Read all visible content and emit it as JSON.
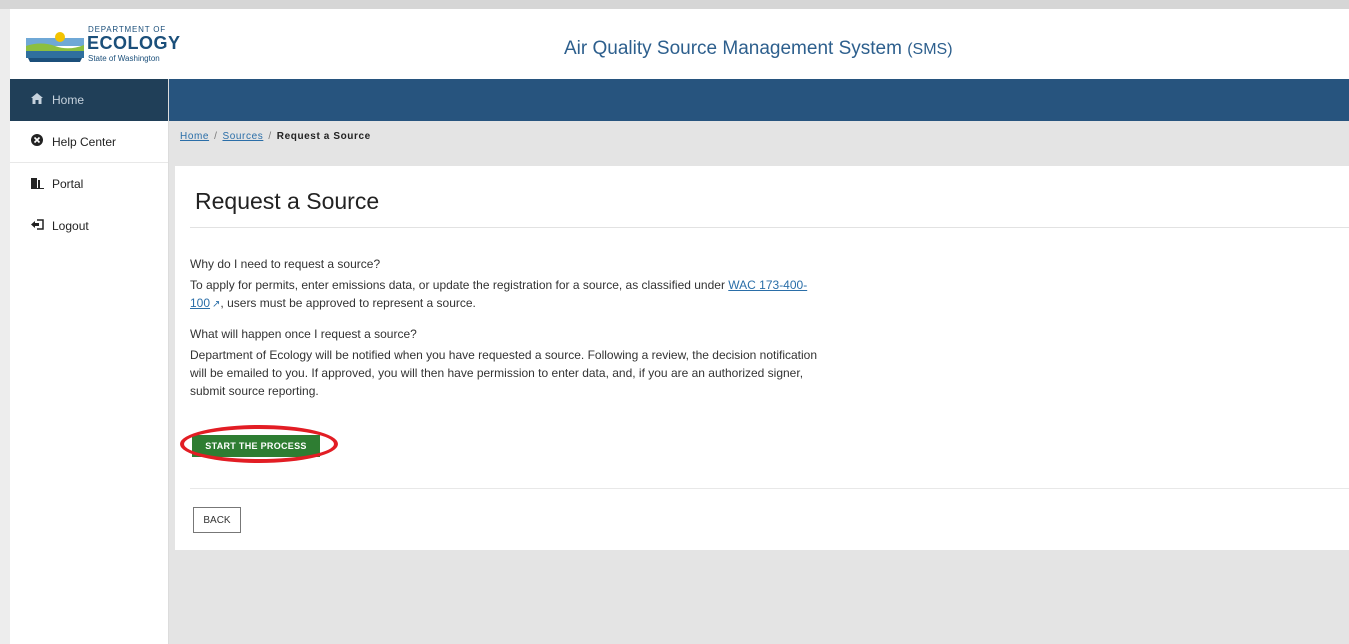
{
  "logo": {
    "dept": "DEPARTMENT OF",
    "name": "ECOLOGY",
    "state": "State of Washington"
  },
  "app": {
    "title": "Air Quality Source Management System",
    "abbr": "(SMS)"
  },
  "sidebar": {
    "items": [
      {
        "label": "Home",
        "icon": "home-icon"
      },
      {
        "label": "Help Center",
        "icon": "help-circle-icon"
      },
      {
        "label": "Portal",
        "icon": "portal-icon"
      },
      {
        "label": "Logout",
        "icon": "logout-icon"
      }
    ]
  },
  "breadcrumb": {
    "home": "Home",
    "sources": "Sources",
    "sep": "/",
    "current": "Request a Source"
  },
  "page": {
    "title": "Request a Source",
    "q1": "Why do I need to request a source?",
    "a1_pre": "To apply for permits, enter emissions data, or update the registration for a source, as classified under ",
    "a1_link": "WAC 173-400-100",
    "a1_post": ", users must be approved to represent a source.",
    "q2": "What will happen once I request a source?",
    "a2": "Department of Ecology will be notified when you have requested a source. Following a review, the decision notification will be emailed to you. If approved, you will then have permission to enter data, and, if you are an authorized signer, submit source reporting.",
    "start_button": "START THE PROCESS",
    "back_button": "BACK"
  },
  "colors": {
    "navbar": "#27547e",
    "sidebar_active": "#203f58",
    "start_button": "#2e7d32",
    "highlight": "#e21d24",
    "link": "#2a6ea8"
  }
}
